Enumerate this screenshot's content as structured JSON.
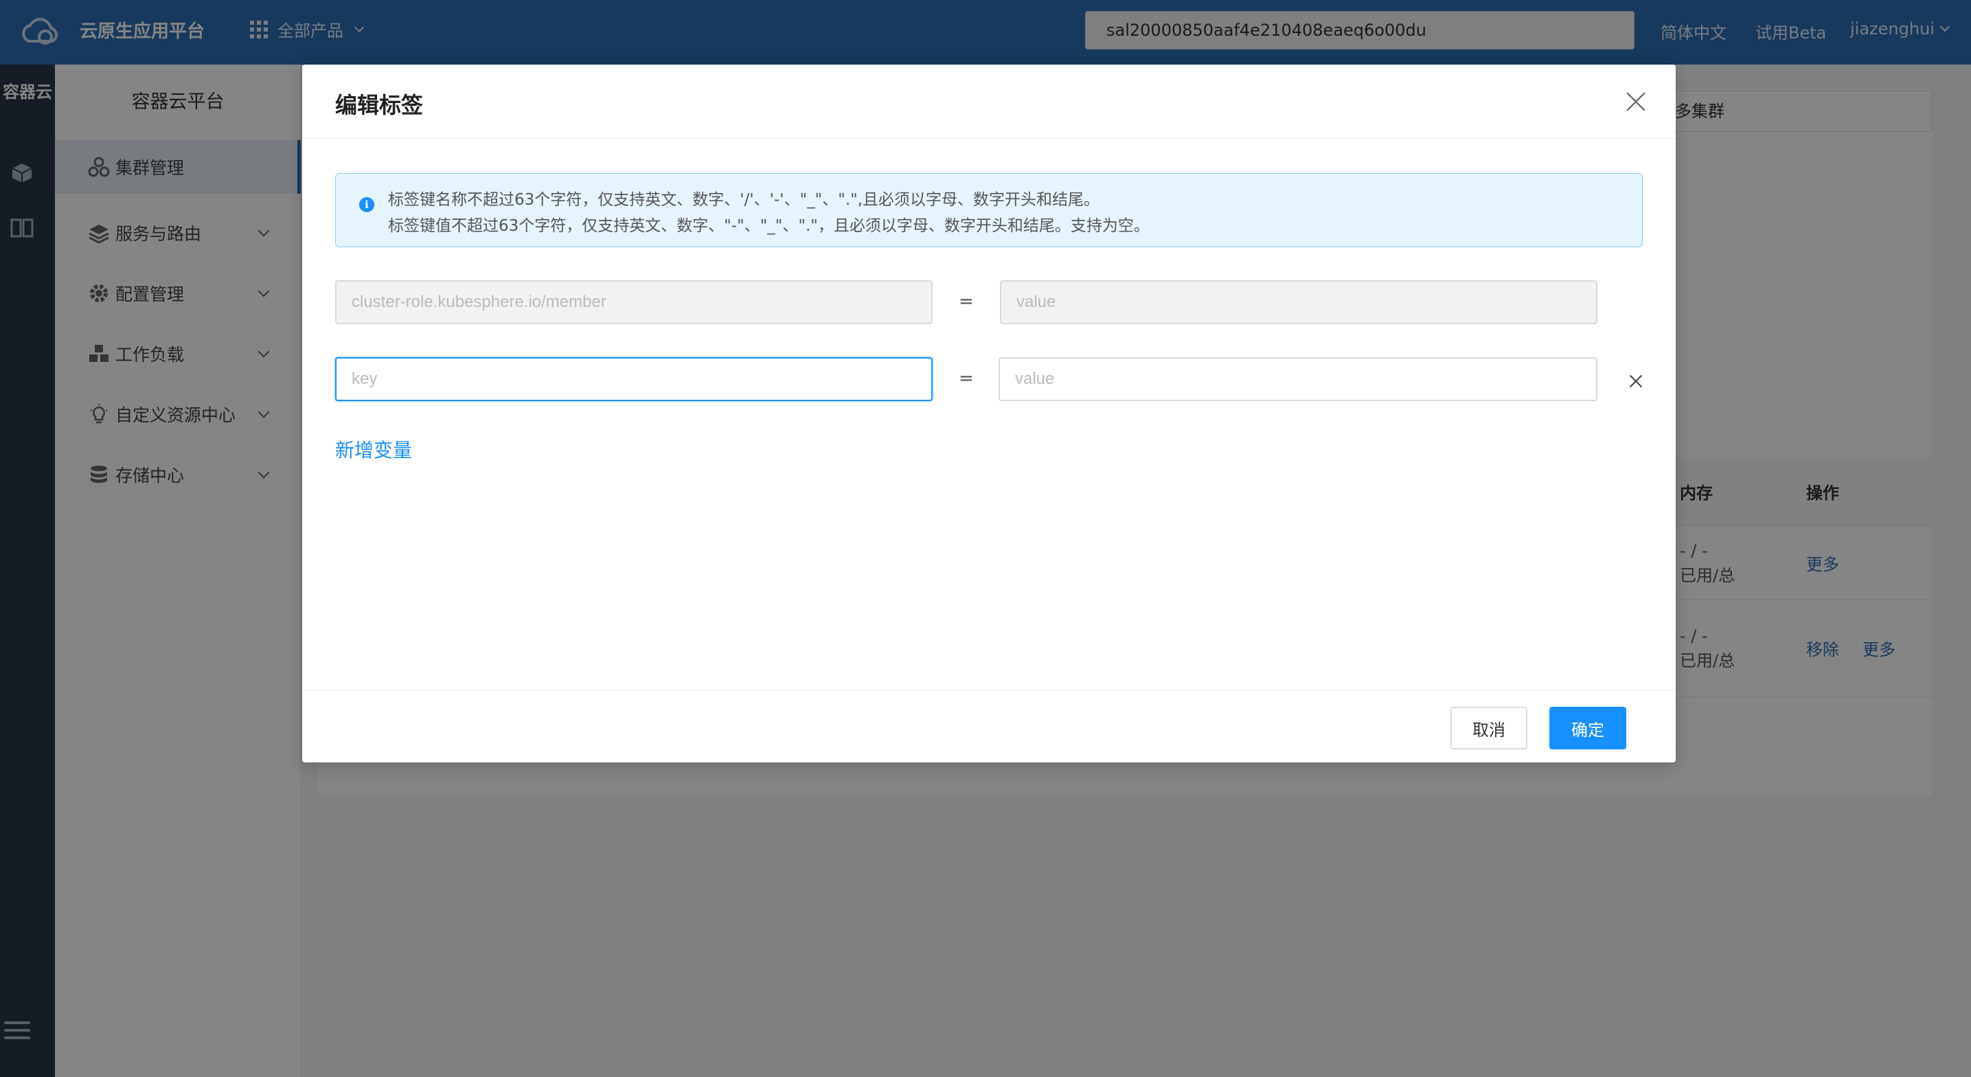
{
  "topbar": {
    "brand": "云原生应用平台",
    "products_label": "全部产品",
    "search_value": "sal20000850aaf4e210408eaeq6o00du",
    "lang_label": "简体中文",
    "beta_label": "试用Beta",
    "user_label": "jiazenghui"
  },
  "rail": {
    "title": "容器云"
  },
  "sidebar": {
    "title": "容器云平台",
    "items": [
      {
        "label": "集群管理",
        "icon": "cluster-icon"
      },
      {
        "label": "服务与路由",
        "icon": "layers-icon"
      },
      {
        "label": "配置管理",
        "icon": "gear-icon"
      },
      {
        "label": "工作负载",
        "icon": "workload-icon"
      },
      {
        "label": "自定义资源中心",
        "icon": "bulb-icon"
      },
      {
        "label": "存储中心",
        "icon": "database-icon"
      }
    ]
  },
  "background": {
    "select_value": "多集群",
    "col_memory": "内存",
    "col_actions": "操作",
    "rows": [
      {
        "mem_value": "- / -",
        "mem_label": "已用/总",
        "more": "更多"
      },
      {
        "mem_value": "- / -",
        "mem_label": "已用/总",
        "remove": "移除",
        "more": "更多"
      }
    ]
  },
  "modal": {
    "title": "编辑标签",
    "alert": {
      "line1": "标签键名称不超过63个字符，仅支持英文、数字、'/'、'-'、\"_\"、\".\",且必须以字母、数字开头和结尾。",
      "line2": "标签键值不超过63个字符，仅支持英文、数字、\"-\"、\"_\"、\".\"，且必须以字母、数字开头和结尾。支持为空。"
    },
    "rows": [
      {
        "key_placeholder": "cluster-role.kubesphere.io/member",
        "value_placeholder": "value",
        "eq": "="
      },
      {
        "key_placeholder": "key",
        "value_placeholder": "value",
        "eq": "="
      }
    ],
    "add_label": "新增变量",
    "cancel_label": "取消",
    "ok_label": "确定"
  },
  "colors": {
    "primary": "#1890ff",
    "topbar": "#2f6eb5",
    "rail": "#2b3648"
  }
}
